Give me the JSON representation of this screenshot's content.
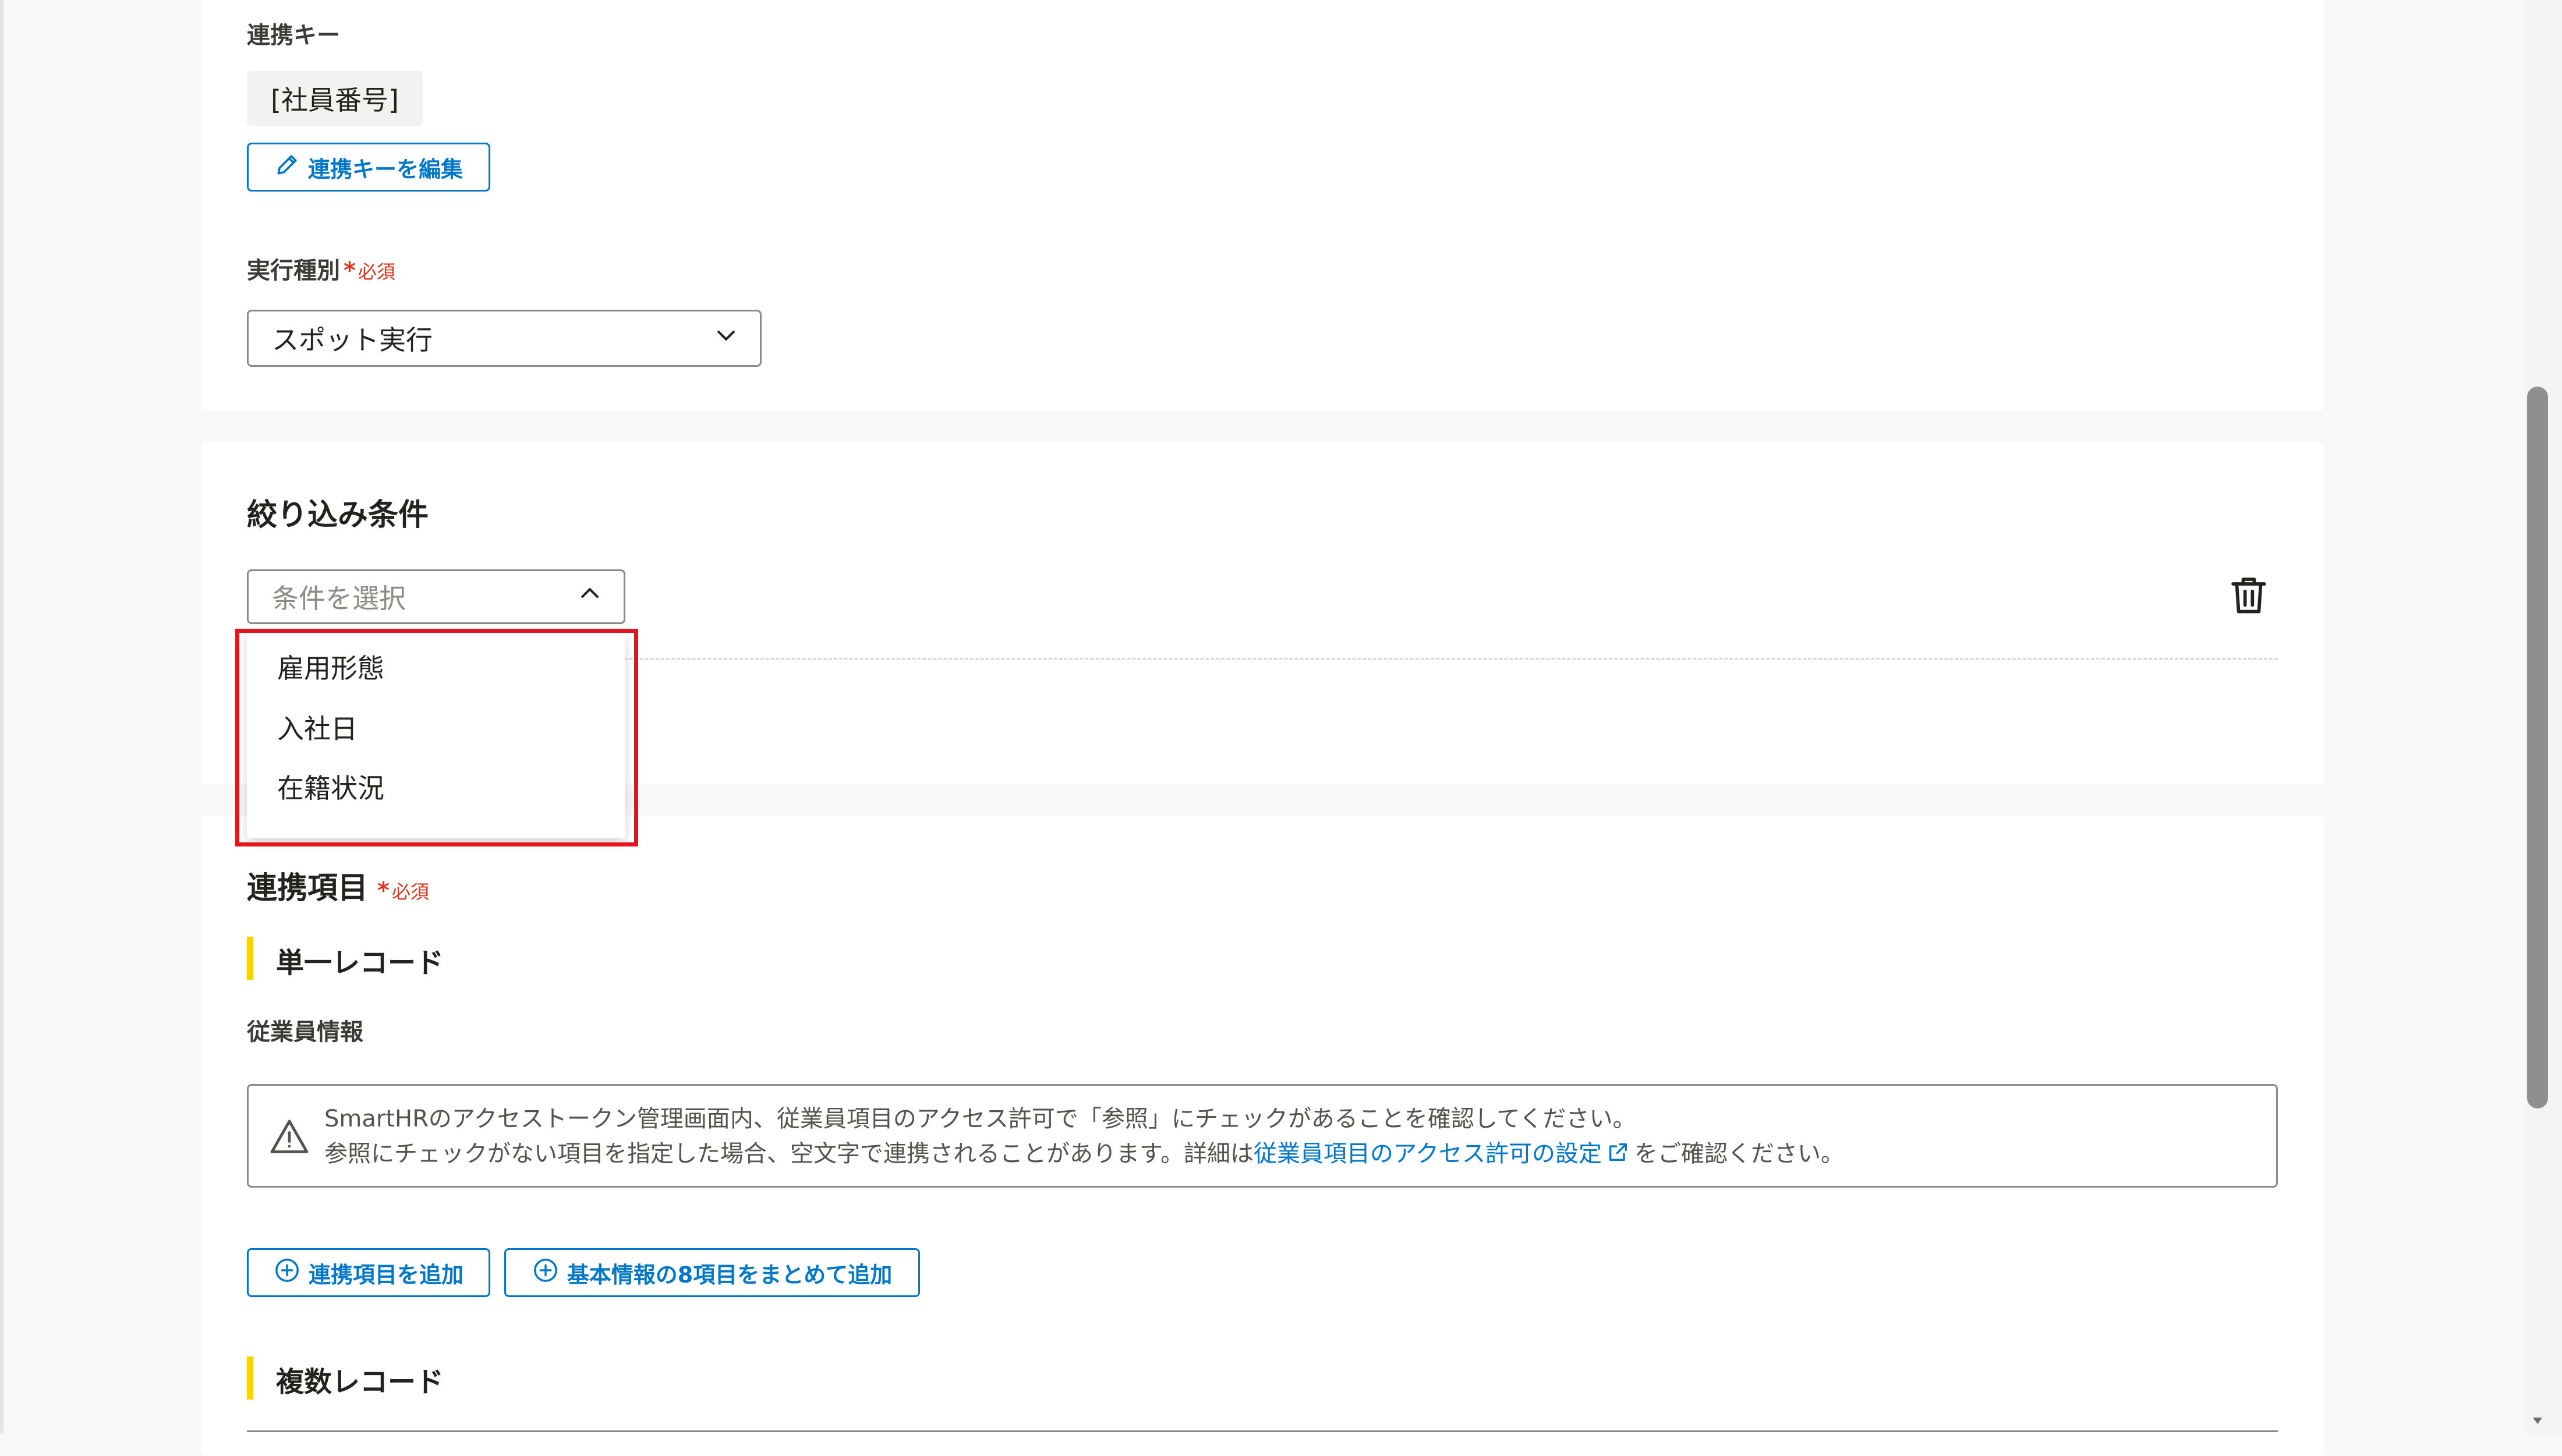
{
  "settings": {
    "key_label": "連携キー",
    "key_value": "[社員番号]",
    "edit_key_button": "連携キーを編集",
    "run_type_label": "実行種別",
    "required_star": "*",
    "required_text": "必須",
    "run_type_value": "スポット実行"
  },
  "filter": {
    "heading": "絞り込み条件",
    "select_placeholder": "条件を選択",
    "options": [
      "雇用形態",
      "入社日",
      "在籍状況"
    ]
  },
  "items": {
    "heading": "連携項目",
    "single_record_heading": "単一レコード",
    "employee_info_label": "従業員情報",
    "alert_line1": "SmartHRのアクセストークン管理画面内、従業員項目のアクセス許可で「参照」にチェックがあることを確認してください。",
    "alert_line2_pre": "参照にチェックがない項目を指定した場合、空文字で連携されることがあります。詳細は",
    "alert_link": "従業員項目のアクセス許可の設定",
    "alert_line2_post": "をご確認ください。",
    "add_item_button": "連携項目を追加",
    "add_basic_button": "基本情報の8項目をまとめて追加",
    "multi_record_heading": "複数レコード"
  },
  "colors": {
    "accent": "#0077c7",
    "required": "#d9391e",
    "highlight": "#e1151b",
    "section_bar": "#fcd200"
  },
  "icons": [
    "pencil-icon",
    "chevron-down-icon",
    "chevron-up-icon",
    "trash-icon",
    "warning-icon",
    "external-link-icon",
    "plus-circle-icon"
  ]
}
